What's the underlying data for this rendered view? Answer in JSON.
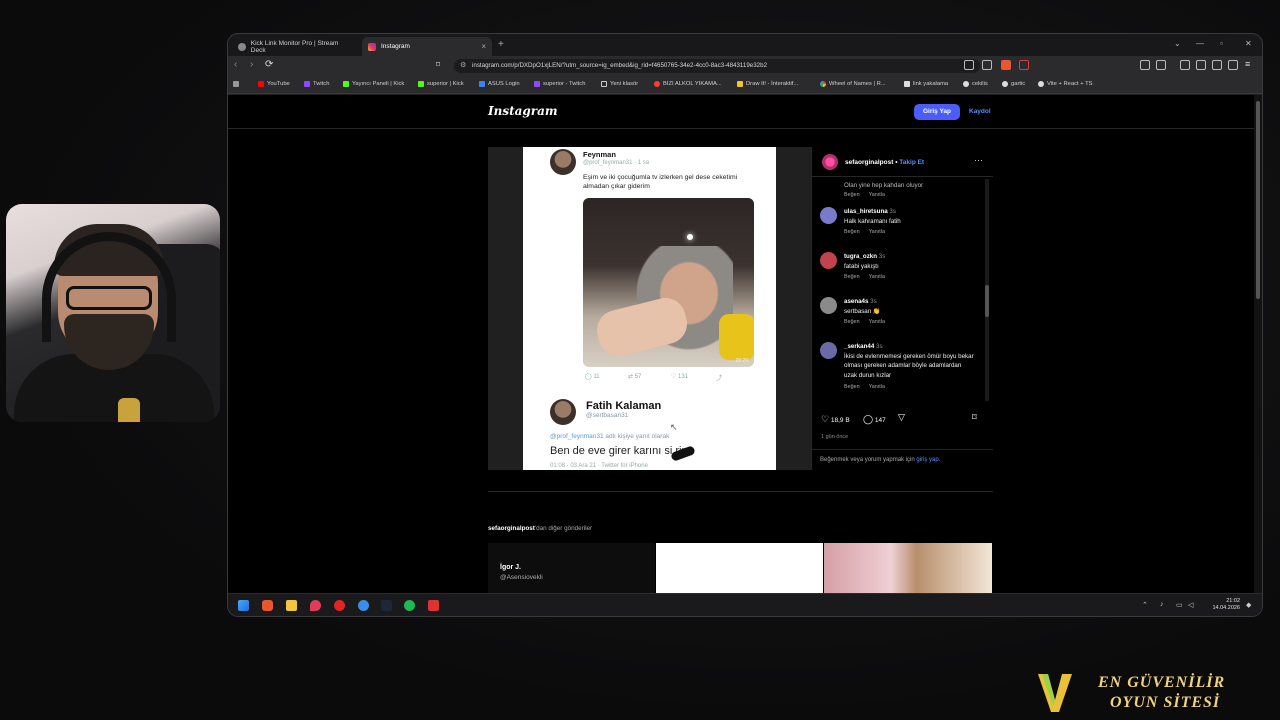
{
  "browser": {
    "tabs": [
      {
        "label": "Kick Link Monitor Pro | Stream Deck"
      },
      {
        "label": "Instagram"
      }
    ],
    "url": "instagram.com/p/DXDpO1xjLEN/?utm_source=ig_embed&ig_rid=f4650765-34e2-4cc0-8ac3-4843119e32b2",
    "bookmarks": [
      {
        "label": "YouTube",
        "color": "#ff0000"
      },
      {
        "label": "Twitch",
        "color": "#9146ff"
      },
      {
        "label": "Yayıncı Paneli | Kick",
        "color": "#53fc18"
      },
      {
        "label": "superior | Kick",
        "color": "#53fc18"
      },
      {
        "label": "ASUS Login",
        "color": "#3b82f6"
      },
      {
        "label": "superior - Twitch",
        "color": "#9146ff"
      },
      {
        "label": "Yeni klasör",
        "color": "#cccccc"
      },
      {
        "label": "BIZI ALKOL YIKAMA...",
        "color": "#ff3b30"
      },
      {
        "label": "Draw It! - İnteraktif...",
        "color": "#f4c430"
      },
      {
        "label": "Wheel of Names | R...",
        "color": "#34a853"
      },
      {
        "label": "link yakalama",
        "color": "#dddddd"
      },
      {
        "label": "cekilis",
        "color": "#dddddd"
      },
      {
        "label": "gartic",
        "color": "#dddddd"
      },
      {
        "label": "Vite + React + TS",
        "color": "#dddddd"
      }
    ]
  },
  "instagram": {
    "logo": "Instagram",
    "login_label": "Giriş Yap",
    "signup_label": "Kaydol",
    "post_user": "sefaorginalpost",
    "follow_label": "Takip Et",
    "likes": "18,9 B",
    "comments_count": "147",
    "time_ago": "1 gün önce",
    "login_prompt_pre": "Beğenmek veya yorum yapmak için ",
    "login_prompt_link": "giriş yap",
    "login_prompt_post": ".",
    "more_posts_user": "sefaorginalpost",
    "more_posts_suffix": "'dan diğer gönderiler",
    "thumb1_name": "İgor J.",
    "thumb1_handle": "@Asensiovekli",
    "comments": [
      {
        "user": "ulas_hiretsuna",
        "time": "3s",
        "text": "Halk kahramanı fatih",
        "color": "#7a7acb"
      },
      {
        "user": "tugra_ozkn",
        "time": "3s",
        "text": "fatabi yakıştı",
        "color": "#c2424d"
      },
      {
        "user": "asena4s",
        "time": "3s",
        "text": "sertbasan 👏",
        "color": "#8a8a8a"
      },
      {
        "user": "_serkan44",
        "time": "3s",
        "text": "İkisi de evlenmemesi gereken ömür boyu bekar olması gereken adamlar böyle adamlardan uzak durun kızlar",
        "color": "#6a6aa8"
      }
    ],
    "comment_like": "Beğen",
    "comment_reply": "Yanıtla",
    "partial_comment_text": "Olan yine hep kahdarı oluyor"
  },
  "tweet": {
    "name": "Feynman",
    "handle": "@prof_feynman31 · 1 sa",
    "text": "Eşim ve iki çocuğumla tv izlerken gel dese ceketimi almadan çıkar giderim",
    "photo_time": "28:29",
    "replies": "11",
    "retweets": "57",
    "likes": "131",
    "reply_name": "Fatih Kalaman",
    "reply_handle": "@sertbasan31",
    "reply_to_pre": "@prof_feynman31",
    "reply_to_post": " adlı kişiye yanıt olarak",
    "reply_text": "Ben de eve girer karını si rim",
    "reply_date": "01:08 · 03 Ara 21 · Twitter for iPhone"
  },
  "taskbar": {
    "time": "21:02",
    "date": "14.04.2026"
  },
  "brand": {
    "line1": "EN GÜVENİLİR",
    "line2": "OYUN SİTESİ"
  }
}
